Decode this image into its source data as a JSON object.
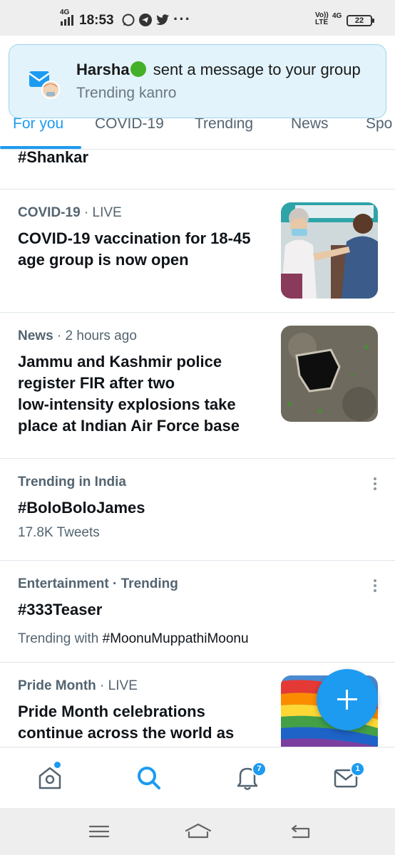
{
  "status_bar": {
    "network_left": "4G",
    "time": "18:53",
    "more": "···",
    "volte_top": "Vo))",
    "volte_bottom": "LTE",
    "network_right": "4G",
    "battery": "22",
    "app_icons": [
      "whatsapp-icon",
      "telegram-icon",
      "twitter-icon"
    ]
  },
  "notification": {
    "sender": "Harsha",
    "message": " sent a message to your group",
    "group": "Trending kanro"
  },
  "tabs": [
    {
      "label": "For you",
      "active": true
    },
    {
      "label": "COVID-19",
      "active": false
    },
    {
      "label": "Trending",
      "active": false
    },
    {
      "label": "News",
      "active": false
    },
    {
      "label": "Spo",
      "active": false
    }
  ],
  "feed": {
    "partial_item": {
      "headline": "#Shankar"
    },
    "items": [
      {
        "category": "COVID-19",
        "separator": " · ",
        "status": "LIVE",
        "headline_lines": [
          "COVID-19 vaccination for 18-45",
          "age group is now open"
        ]
      },
      {
        "category": "News",
        "separator": " · ",
        "status": "2 hours ago",
        "headline_lines": [
          "Jammu and Kashmir police",
          "register FIR after two",
          "low-intensity explosions take",
          "place at Indian Air Force base"
        ]
      },
      {
        "context": "Trending in India",
        "headline": "#BoloBoloJames",
        "count": "17.8K Tweets"
      },
      {
        "context": "Entertainment · Trending",
        "headline": "#333Teaser",
        "trending_with_label": "Trending with ",
        "trending_with_tag": "#MoonuMuppathiMoonu"
      },
      {
        "category": "Pride Month",
        "separator": " · ",
        "status": "LIVE",
        "headline_lines": [
          "Pride Month celebrations",
          "continue across the world as"
        ]
      }
    ]
  },
  "bottom_nav": {
    "notifications_badge": "7",
    "messages_badge": "1",
    "active": "search"
  },
  "colors": {
    "accent": "#1d9bf0",
    "secondary_text": "#536471",
    "notification_bg": "#e2f3fb"
  }
}
